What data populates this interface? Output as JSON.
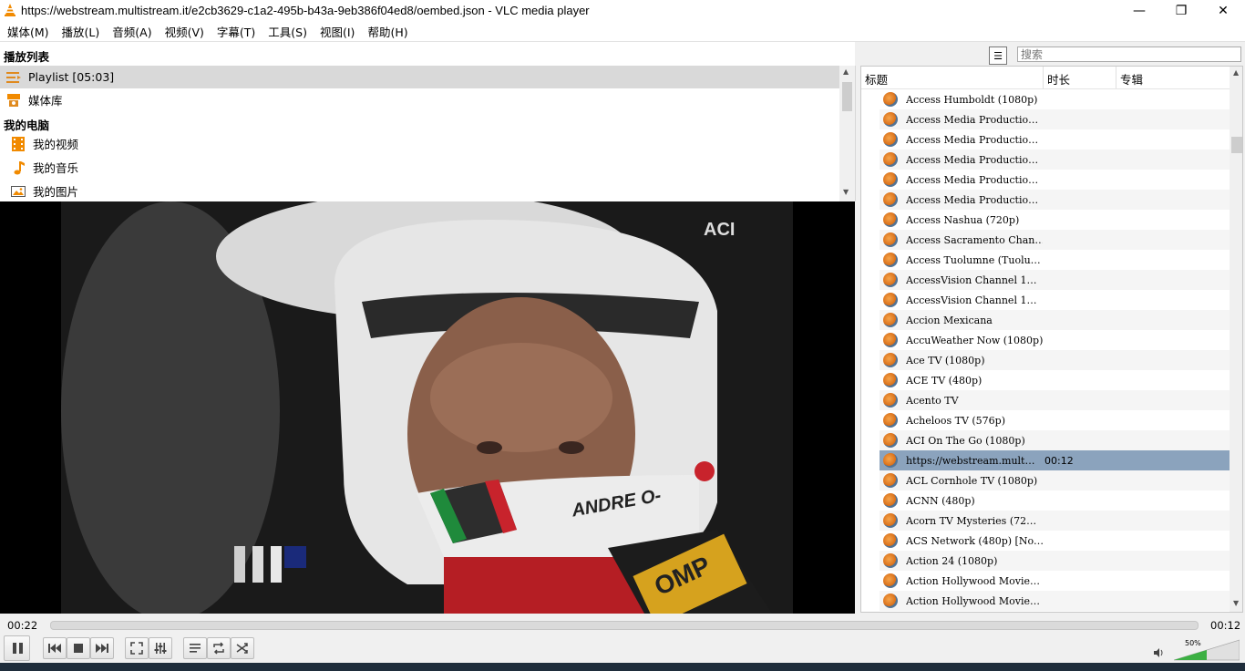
{
  "window": {
    "title": "https://webstream.multistream.it/e2cb3629-c1a2-495b-b43a-9eb386f04ed8/oembed.json - VLC media player",
    "controls": [
      "—",
      "❐",
      "✕"
    ]
  },
  "menu": [
    "媒体(M)",
    "播放(L)",
    "音频(A)",
    "视频(V)",
    "字幕(T)",
    "工具(S)",
    "视图(I)",
    "帮助(H)"
  ],
  "sidebar": {
    "header": "播放列表",
    "playlist_item": "Playlist [05:03]",
    "library_item": "媒体库",
    "my_computer": "我的电脑",
    "items": [
      "我的视频",
      "我的音乐",
      "我的图片"
    ]
  },
  "search": {
    "placeholder": "搜索"
  },
  "playlist": {
    "columns": [
      "标题",
      "时长",
      "专辑"
    ],
    "rows": [
      {
        "title": "Access Humboldt (1080p)",
        "duration": ""
      },
      {
        "title": "Access Media Productio…",
        "duration": ""
      },
      {
        "title": "Access Media Productio…",
        "duration": ""
      },
      {
        "title": "Access Media Productio…",
        "duration": ""
      },
      {
        "title": "Access Media Productio…",
        "duration": ""
      },
      {
        "title": "Access Media Productio…",
        "duration": ""
      },
      {
        "title": "Access Nashua (720p)",
        "duration": ""
      },
      {
        "title": "Access Sacramento Chan…",
        "duration": ""
      },
      {
        "title": "Access Tuolumne (Tuolu…",
        "duration": ""
      },
      {
        "title": "AccessVision Channel 1…",
        "duration": ""
      },
      {
        "title": "AccessVision Channel 1…",
        "duration": ""
      },
      {
        "title": "Accion Mexicana",
        "duration": ""
      },
      {
        "title": "AccuWeather Now (1080p)",
        "duration": ""
      },
      {
        "title": "Ace TV (1080p)",
        "duration": ""
      },
      {
        "title": "ACE TV (480p)",
        "duration": ""
      },
      {
        "title": "Acento TV",
        "duration": ""
      },
      {
        "title": "Acheloos TV (576p)",
        "duration": ""
      },
      {
        "title": "ACI On The Go (1080p)",
        "duration": ""
      },
      {
        "title": "https://webstream.mult…",
        "duration": "00:12"
      },
      {
        "title": "ACL Cornhole TV (1080p)",
        "duration": ""
      },
      {
        "title": "ACNN (480p)",
        "duration": ""
      },
      {
        "title": "Acorn TV Mysteries (72…",
        "duration": ""
      },
      {
        "title": "ACS Network (480p) [No…",
        "duration": ""
      },
      {
        "title": "Action 24 (1080p)",
        "duration": ""
      },
      {
        "title": "Action Hollywood Movie…",
        "duration": ""
      },
      {
        "title": "Action Hollywood Movie…",
        "duration": ""
      }
    ]
  },
  "video_overlay": {
    "channel_logo": "ACI",
    "helmet_text": "ANDRE O-",
    "brand_text": "OMP"
  },
  "player": {
    "elapsed": "00:22",
    "total": "00:12",
    "volume": "50%",
    "volume_level": 0.5
  },
  "colors": {
    "selected_row": "#8ba3bd",
    "vlc_orange": "#f18a00",
    "volume_green": "#3cb043"
  }
}
